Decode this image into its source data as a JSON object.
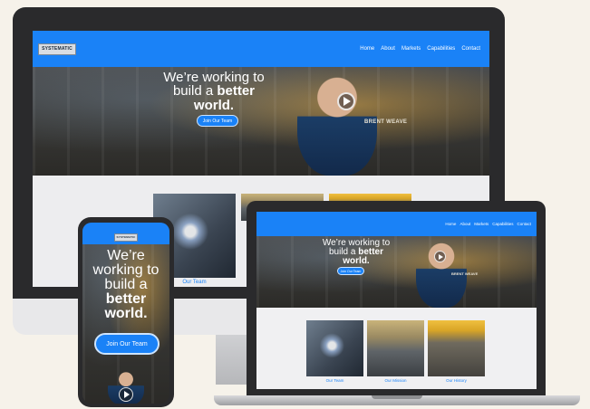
{
  "brand": {
    "logo_text": "SYSTEMATIC",
    "accent": "#1a82f7"
  },
  "nav": {
    "items": [
      "Home",
      "About",
      "Markets",
      "Capabilities",
      "Contact"
    ]
  },
  "hero": {
    "line1": "We’re working to",
    "line2_pre": "build a ",
    "line2_bold": "better",
    "line3": "world.",
    "cta": "Join Our Team",
    "name_overlay": "BRENT WEAVE"
  },
  "cards": [
    {
      "label": "Our Team"
    },
    {
      "label": "Our Mission"
    },
    {
      "label": "Our History"
    }
  ],
  "mobile": {
    "line1": "We’re",
    "line2": "working to",
    "line3": "build a",
    "line4_bold": "better",
    "line5_bold": "world.",
    "cta": "Join Our Team"
  }
}
